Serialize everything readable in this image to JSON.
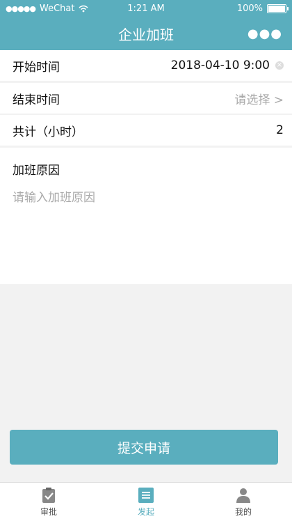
{
  "status_bar": {
    "carrier": "WeChat",
    "time": "1:21 AM",
    "battery": "100%",
    "battery_level": 1.0
  },
  "header": {
    "title": "企业加班",
    "more_icon": "more-icon"
  },
  "form": {
    "start": {
      "label": "开始时间",
      "value": "2018-04-10 9:00"
    },
    "end": {
      "label": "结束时间",
      "placeholder": "请选择 >"
    },
    "total": {
      "label": "共计（小时）",
      "value": "2"
    },
    "reason": {
      "label": "加班原因",
      "placeholder": "请输入加班原因"
    }
  },
  "submit_label": "提交申请",
  "tabs": [
    {
      "label": "审批",
      "icon": "clipboard-check-icon"
    },
    {
      "label": "发起",
      "icon": "list-icon"
    },
    {
      "label": "我的",
      "icon": "person-icon"
    }
  ],
  "colors": {
    "accent": "#5aaebe",
    "background": "#f2f2f2"
  }
}
